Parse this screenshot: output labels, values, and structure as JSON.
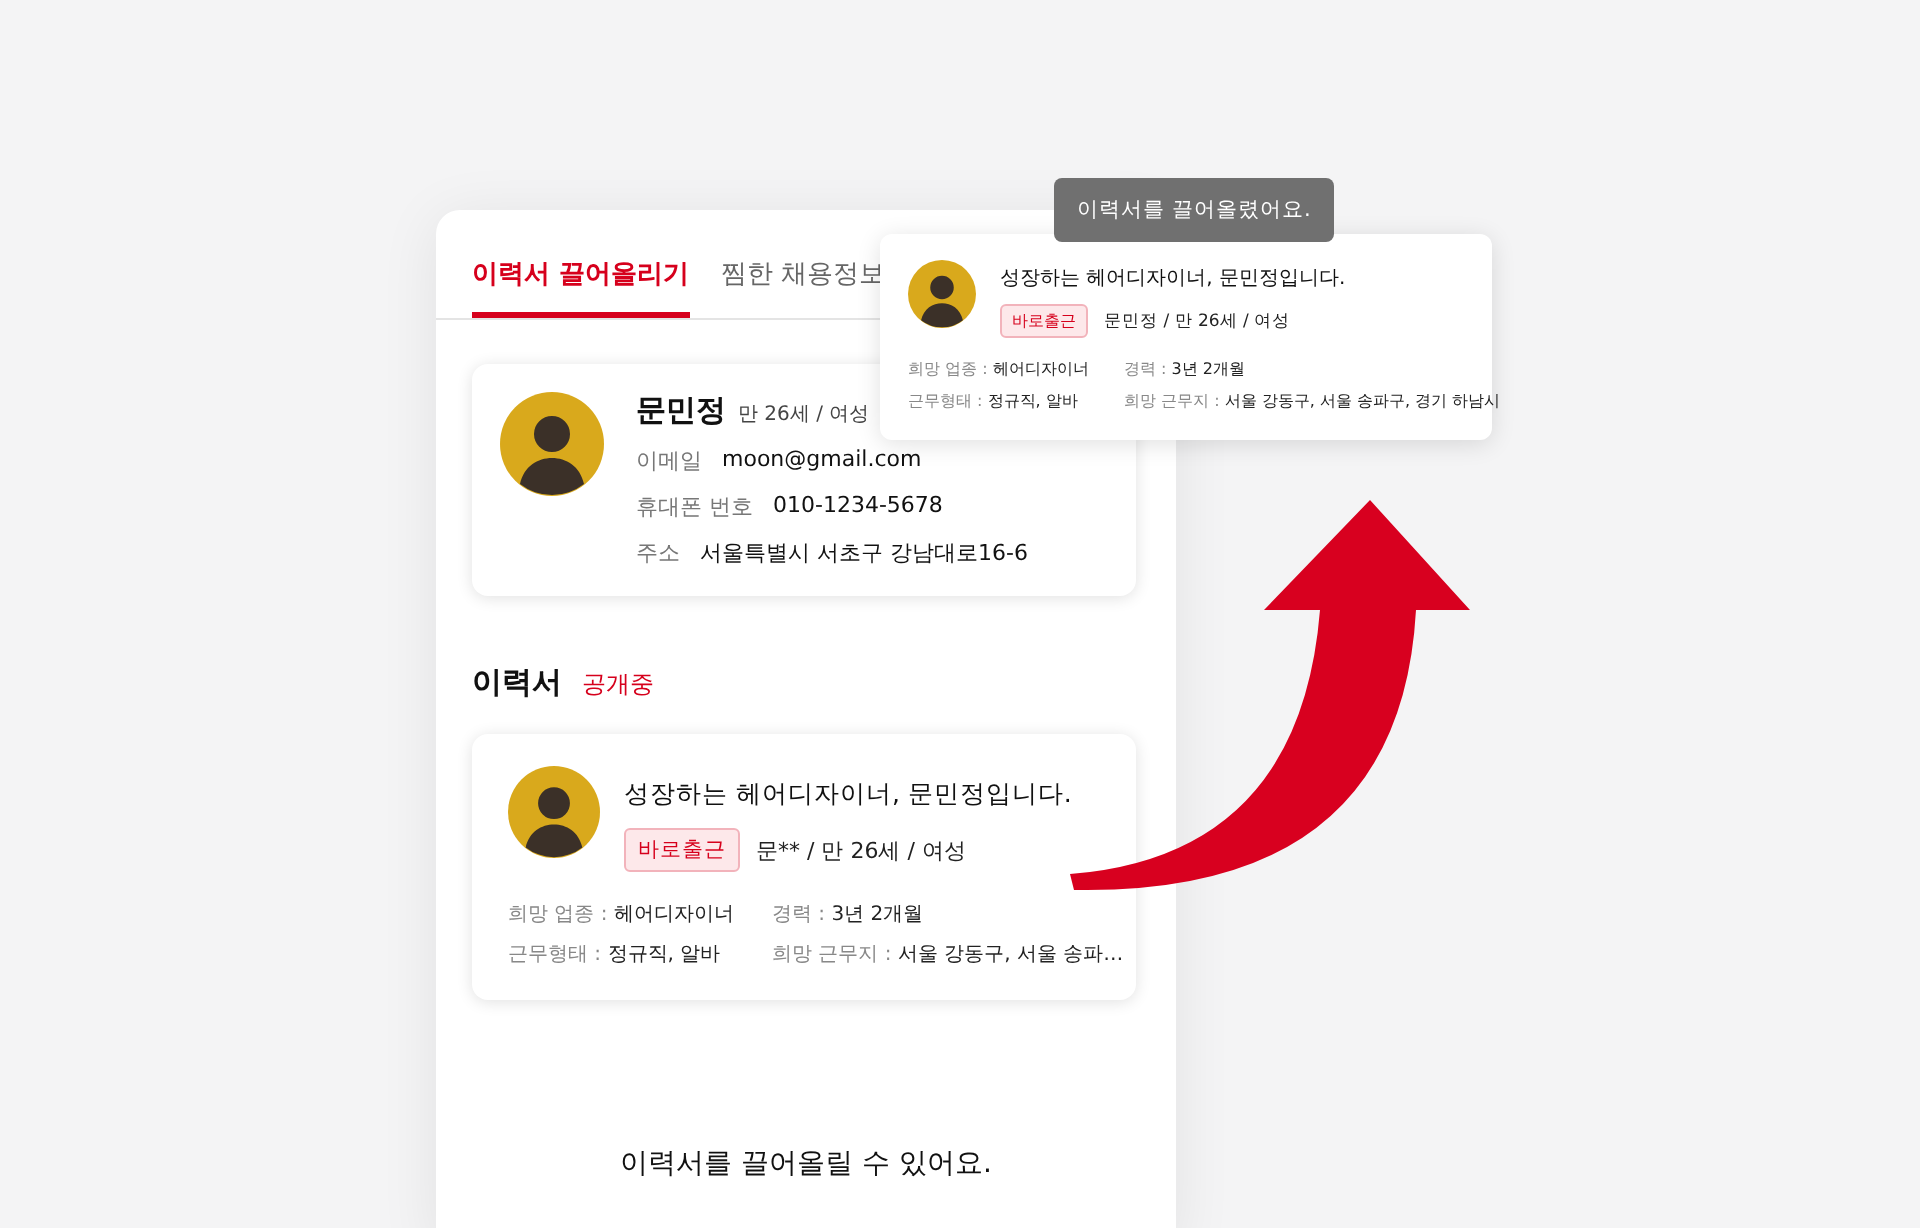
{
  "tabs": [
    {
      "label": "이력서 끌어올리기",
      "selected": true
    },
    {
      "label": "찜한 채용정보",
      "selected": false
    }
  ],
  "profile": {
    "name": "문민정",
    "age_gender": "만 26세 / 여성",
    "fields": [
      {
        "label": "이메일",
        "value": "moon@gmail.com"
      },
      {
        "label": "휴대폰 번호",
        "value": "010-1234-5678"
      },
      {
        "label": "주소",
        "value": "서울특별시 서초구 강남대로16-6"
      }
    ]
  },
  "resume_section": {
    "title": "이력서",
    "status": "공개중"
  },
  "resume_card": {
    "title": "성장하는 헤어디자이너, 문민정입니다.",
    "badge": "바로출근",
    "summary": "문** / 만 26세 / 여성",
    "details": [
      {
        "label": "희망 업종 :",
        "value": "헤어디자이너"
      },
      {
        "label": "경력 :",
        "value": "3년 2개월"
      },
      {
        "label": "근무형태 :",
        "value": "정규직, 알바"
      },
      {
        "label": "희망 근무지 :",
        "value": "서울 강동구, 서울 송파…"
      }
    ]
  },
  "footer_text": "이력서를 끌어올릴 수 있어요.",
  "toast": "이력서를 끌어올렸어요.",
  "popup_card": {
    "title": "성장하는 헤어디자이너, 문민정입니다.",
    "badge": "바로출근",
    "summary": "문민정 / 만 26세 / 여성",
    "details": [
      {
        "label": "희망 업종 :",
        "value": "헤어디자이너"
      },
      {
        "label": "경력 :",
        "value": "3년 2개월"
      },
      {
        "label": "근무형태 :",
        "value": "정규직, 알바"
      },
      {
        "label": "희망 근무지 :",
        "value": "서울 강동구, 서울 송파구, 경기 하남시"
      }
    ]
  }
}
